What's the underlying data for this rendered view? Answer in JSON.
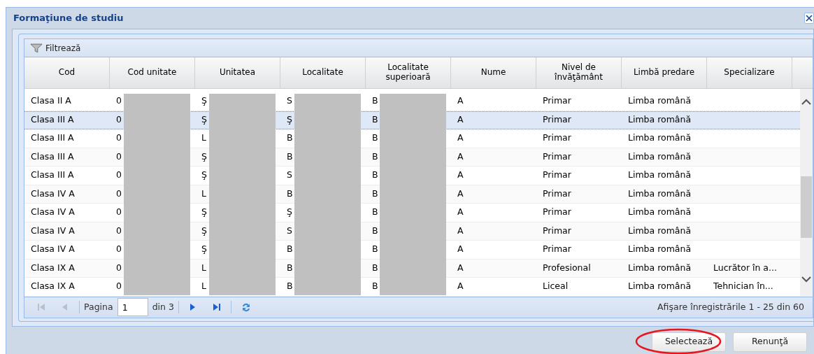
{
  "window": {
    "title": "Formaţiune de studiu"
  },
  "toolbar": {
    "filter_label": "Filtrează"
  },
  "table": {
    "columns": [
      {
        "label": "Cod",
        "redacted": false
      },
      {
        "label": "Cod unitate",
        "redacted": true
      },
      {
        "label": "Unitatea",
        "redacted": true
      },
      {
        "label": "Localitate",
        "redacted": true
      },
      {
        "label": "Localitate superioară",
        "redacted": true
      },
      {
        "label": "Nume",
        "redacted": false
      },
      {
        "label": "Nivel de învăţământ",
        "redacted": false
      },
      {
        "label": "Limbă predare",
        "redacted": false
      },
      {
        "label": "Specializare",
        "redacted": false
      }
    ],
    "rows": [
      {
        "selected": false,
        "cells": [
          "Clasa II A",
          "0",
          "Ş",
          "S",
          "B",
          "A",
          "Primar",
          "Limba română",
          ""
        ]
      },
      {
        "selected": true,
        "cells": [
          "Clasa III A",
          "0",
          "Ş",
          "Ş",
          "B",
          "A",
          "Primar",
          "Limba română",
          ""
        ]
      },
      {
        "selected": false,
        "cells": [
          "Clasa III A",
          "0",
          "L",
          "B",
          "B",
          "A",
          "Primar",
          "Limba română",
          ""
        ]
      },
      {
        "selected": false,
        "cells": [
          "Clasa III A",
          "0",
          "Ş",
          "B",
          "B",
          "A",
          "Primar",
          "Limba română",
          ""
        ]
      },
      {
        "selected": false,
        "cells": [
          "Clasa III A",
          "0",
          "Ş",
          "S",
          "B",
          "A",
          "Primar",
          "Limba română",
          ""
        ]
      },
      {
        "selected": false,
        "cells": [
          "Clasa IV A",
          "0",
          "L",
          "B",
          "B",
          "A",
          "Primar",
          "Limba română",
          ""
        ]
      },
      {
        "selected": false,
        "cells": [
          "Clasa IV A",
          "0",
          "Ş",
          "Ş",
          "B",
          "A",
          "Primar",
          "Limba română",
          ""
        ]
      },
      {
        "selected": false,
        "cells": [
          "Clasa IV A",
          "0",
          "Ş",
          "S",
          "B",
          "A",
          "Primar",
          "Limba română",
          ""
        ]
      },
      {
        "selected": false,
        "cells": [
          "Clasa IV A",
          "0",
          "Ş",
          "B",
          "B",
          "A",
          "Primar",
          "Limba română",
          ""
        ]
      },
      {
        "selected": false,
        "cells": [
          "Clasa IX A",
          "0",
          "L",
          "B",
          "B",
          "A",
          "Profesional",
          "Limba română",
          "Lucrător în a..."
        ]
      },
      {
        "selected": false,
        "cells": [
          "Clasa IX A",
          "0",
          "L",
          "B",
          "B",
          "A",
          "Liceal",
          "Limba română",
          "Tehnician în..."
        ]
      }
    ]
  },
  "paging": {
    "page_label": "Pagina",
    "page": "1",
    "of_label": "din 3",
    "summary": "Afişare înregistrările 1 - 25 din 60",
    "nav": [
      {
        "kind": "first",
        "disabled": true
      },
      {
        "kind": "prev",
        "disabled": true
      },
      {
        "kind": "sep"
      },
      {
        "kind": "page"
      },
      {
        "kind": "sep"
      },
      {
        "kind": "next",
        "disabled": false
      },
      {
        "kind": "last",
        "disabled": false
      },
      {
        "kind": "sep"
      },
      {
        "kind": "refresh",
        "disabled": false
      }
    ]
  },
  "buttons": [
    {
      "label": "Selectează",
      "highlighted": true
    },
    {
      "label": "Renunţă",
      "highlighted": false
    }
  ]
}
